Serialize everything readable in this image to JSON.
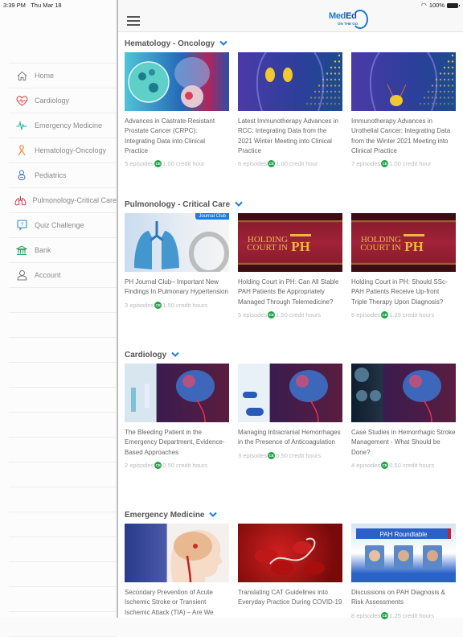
{
  "status_bar": {
    "time": "3:39 PM",
    "date": "Thu Mar 18",
    "battery": "100%",
    "wifi_icon": "wifi-icon",
    "battery_icon": "battery-icon"
  },
  "app": {
    "logo_text_part1": "Med",
    "logo_text_part2": "Ed",
    "logo_subtitle": "ON THE GO",
    "menu_icon": "hamburger-menu-icon"
  },
  "sidebar": {
    "items": [
      {
        "label": "Home",
        "icon": "home-icon",
        "color": "#777777"
      },
      {
        "label": "Cardiology",
        "icon": "heart-pulse-icon",
        "color": "#e0454f"
      },
      {
        "label": "Emergency Medicine",
        "icon": "ecg-icon",
        "color": "#1fb5a3"
      },
      {
        "label": "Hematology-Oncology",
        "icon": "ribbon-icon",
        "color": "#f08a4b"
      },
      {
        "label": "Pediatrics",
        "icon": "baby-icon",
        "color": "#3a6fc9"
      },
      {
        "label": "Pulmonology-Critical Care",
        "icon": "lungs-icon",
        "color": "#b0304a"
      },
      {
        "label": "Quiz Challenge",
        "icon": "question-bubble-icon",
        "color": "#2a8be0"
      },
      {
        "label": "Bank",
        "icon": "bank-icon",
        "color": "#2aa866"
      },
      {
        "label": "Account",
        "icon": "user-icon",
        "color": "#777777"
      }
    ]
  },
  "sections": [
    {
      "title": "Hematology - Oncology",
      "cards": [
        {
          "title": "Advances in Castrate-Resistant Prostate Cancer (CRPC): Integrating Data into Clinical Practice",
          "episodes": "5 episodes",
          "credits": "1.00 credit hour",
          "thumb": "prostate"
        },
        {
          "title": "Latest Immunotherapy Advances in RCC: Integrating Data from the 2021 Winter Meeting into Clinical Practice",
          "episodes": "6 episodes",
          "credits": "1.00 credit hour",
          "thumb": "kidney"
        },
        {
          "title": "Immunotherapy Advances in Urothelial Cancer: Integrating Data from the Winter 2021 Meeting into Clinical Practice",
          "episodes": "7 episodes",
          "credits": "1.00 credit hour",
          "thumb": "bladder"
        }
      ]
    },
    {
      "title": "Pulmonology - Critical Care",
      "cards": [
        {
          "title": "PH Journal Club– Important New Findings In Pulmonary Hypertension",
          "episodes": "3 episodes",
          "credits": "1.50 credit hours",
          "thumb": "journal",
          "badge": "Journal Club"
        },
        {
          "title": "Holding Court in PH: Can All Stable PAH Patients Be Appropriately Managed Through Telemedicine?",
          "episodes": "5 episodes",
          "credits": "1.50 credit hours",
          "thumb": "holding",
          "thumb_text1": "HOLDING",
          "thumb_text2": "COURT IN",
          "thumb_text3": "PH"
        },
        {
          "title": "Holding Court in PH: Should SSc-PAH Patients Receive Up-front Triple Therapy Upon Diagnosis?",
          "episodes": "5 episodes",
          "credits": "1.25 credit hours",
          "thumb": "holding",
          "thumb_text1": "HOLDING",
          "thumb_text2": "COURT IN",
          "thumb_text3": "PH"
        }
      ]
    },
    {
      "title": "Cardiology",
      "cards": [
        {
          "title": "The Bleeding Patient in the Emergency Department, Evidence-Based Approaches",
          "episodes": "2 episodes",
          "credits": "0.50 credit hours",
          "thumb": "brain-er"
        },
        {
          "title": "Managing Intracranial Hemorrhages in the Presence of Anticoagulation",
          "episodes": "3 episodes",
          "credits": "0.50 credit hours",
          "thumb": "brain-pills"
        },
        {
          "title": "Case Studies in Hemorrhagic Stroke Management - What Should be Done?",
          "episodes": "4 episodes",
          "credits": "0.50 credit hours",
          "thumb": "brain-scans"
        }
      ]
    },
    {
      "title": "Emergency Medicine",
      "cards": [
        {
          "title": "Secondary Prevention of Acute Ischemic Stroke or Transient Ischemic Attack (TIA) – Are We",
          "episodes": "",
          "credits": "",
          "thumb": "tia"
        },
        {
          "title": "Translating CAT Guidelines into Everyday Practice During COVID-19",
          "episodes": "",
          "credits": "",
          "thumb": "cat"
        },
        {
          "title": "Discussions on PAH Diagnosis & Risk Assessments",
          "episodes": "8 episodes",
          "credits": "1.25 credit hours",
          "thumb": "pah",
          "thumb_text1": "PAH Roundtable"
        }
      ]
    }
  ],
  "ce_badge": "CE",
  "colors": {
    "accent": "#1f78c8",
    "ce_green": "#1fa34a",
    "chevron": "#1a7de3"
  }
}
